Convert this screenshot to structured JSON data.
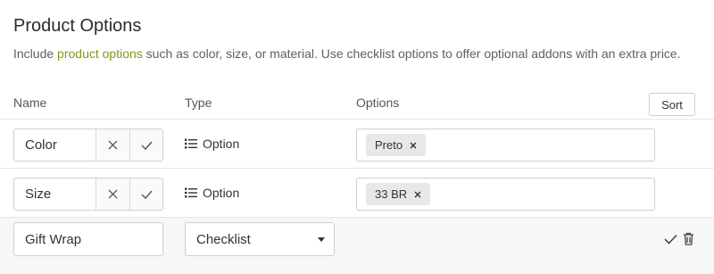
{
  "header": {
    "title": "Product Options",
    "desc_before": "Include ",
    "desc_link": "product options",
    "desc_after": " such as color, size, or material. Use checklist options to offer optional addons with an extra price."
  },
  "columns": {
    "name": "Name",
    "type": "Type",
    "options": "Options"
  },
  "sort_label": "Sort",
  "rows": [
    {
      "name": "Color",
      "type": "Option",
      "tags": [
        "Preto"
      ]
    },
    {
      "name": "Size",
      "type": "Option",
      "tags": [
        "33 BR"
      ]
    }
  ],
  "new_row": {
    "name": "Gift Wrap",
    "type": "Checklist"
  },
  "colors": {
    "link": "#7a9a1a",
    "row_highlight": "#f6f7f8",
    "tag_bg": "#e8e8e8"
  },
  "icons": {
    "cancel": "close-icon",
    "confirm": "check-icon",
    "type": "list-icon",
    "delete": "trash-icon",
    "tag_remove": "close-icon"
  }
}
